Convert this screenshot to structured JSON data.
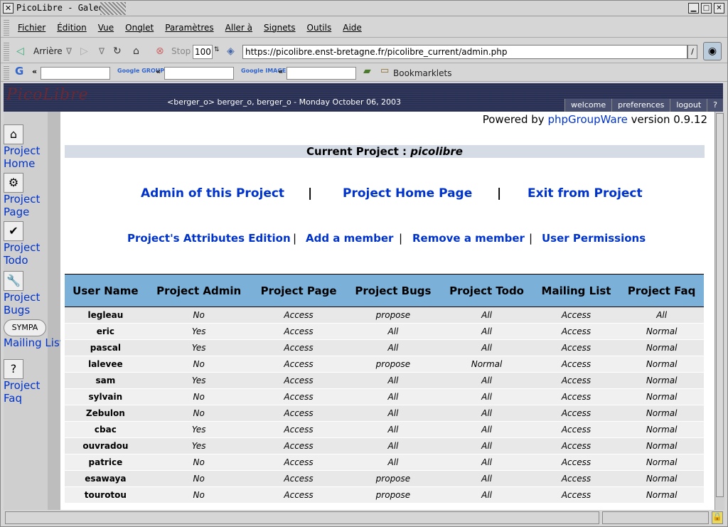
{
  "window": {
    "title": "PicoLibre - Galeon"
  },
  "menu": [
    "Fichier",
    "Édition",
    "Vue",
    "Onglet",
    "Paramètres",
    "Aller à",
    "Signets",
    "Outils",
    "Aide"
  ],
  "nav": {
    "back": "Arrière",
    "stop": "Stop",
    "zoom": "100",
    "url": "https://picolibre.enst-bretagne.fr/picolibre_current/admin.php"
  },
  "search": {
    "bookmarklets": "Bookmarklets",
    "google_groups": "Google GROUPS",
    "google_images": "Google IMAGES"
  },
  "header": {
    "logo": "PicoLibre",
    "userline": "<berger_o> berger_o, berger_o - Monday October 06, 2003",
    "topnav": [
      "welcome",
      "preferences",
      "logout",
      "?"
    ]
  },
  "sidebar": [
    {
      "label": "Project Home",
      "icon": "house-icon"
    },
    {
      "label": "Project Page",
      "icon": "gears-icon"
    },
    {
      "label": "Project Todo",
      "icon": "calendar-check-icon"
    },
    {
      "label": "Project Bugs",
      "icon": "wrench-icon"
    },
    {
      "label": "Mailing List",
      "icon": "sympa-logo-icon"
    },
    {
      "label": "Project Faq",
      "icon": "faq-icon"
    }
  ],
  "powered": {
    "prefix": "Powered by ",
    "link": "phpGroupWare",
    "suffix": " version 0.9.12"
  },
  "current_project": {
    "label": "Current Project : ",
    "name": "picolibre"
  },
  "links_main": [
    "Admin of this Project",
    "Project Home Page",
    "Exit from Project"
  ],
  "links_sub": [
    "Project's Attributes Edition",
    "Add a member",
    "Remove a member",
    "User Permissions"
  ],
  "table": {
    "headers": [
      "User Name",
      "Project Admin",
      "Project Page",
      "Project Bugs",
      "Project Todo",
      "Mailing List",
      "Project Faq"
    ],
    "rows": [
      [
        "legleau",
        "No",
        "Access",
        "propose",
        "All",
        "Access",
        "All"
      ],
      [
        "eric",
        "Yes",
        "Access",
        "All",
        "All",
        "Access",
        "Normal"
      ],
      [
        "pascal",
        "Yes",
        "Access",
        "All",
        "All",
        "Access",
        "Normal"
      ],
      [
        "lalevee",
        "No",
        "Access",
        "propose",
        "Normal",
        "Access",
        "Normal"
      ],
      [
        "sam",
        "Yes",
        "Access",
        "All",
        "All",
        "Access",
        "Normal"
      ],
      [
        "sylvain",
        "No",
        "Access",
        "All",
        "All",
        "Access",
        "Normal"
      ],
      [
        "Zebulon",
        "No",
        "Access",
        "All",
        "All",
        "Access",
        "Normal"
      ],
      [
        "cbac",
        "Yes",
        "Access",
        "All",
        "All",
        "Access",
        "Normal"
      ],
      [
        "ouvradou",
        "Yes",
        "Access",
        "All",
        "All",
        "Access",
        "Normal"
      ],
      [
        "patrice",
        "No",
        "Access",
        "All",
        "All",
        "Access",
        "Normal"
      ],
      [
        "esawaya",
        "No",
        "Access",
        "propose",
        "All",
        "Access",
        "Normal"
      ],
      [
        "tourotou",
        "No",
        "Access",
        "propose",
        "All",
        "Access",
        "Normal"
      ]
    ]
  }
}
